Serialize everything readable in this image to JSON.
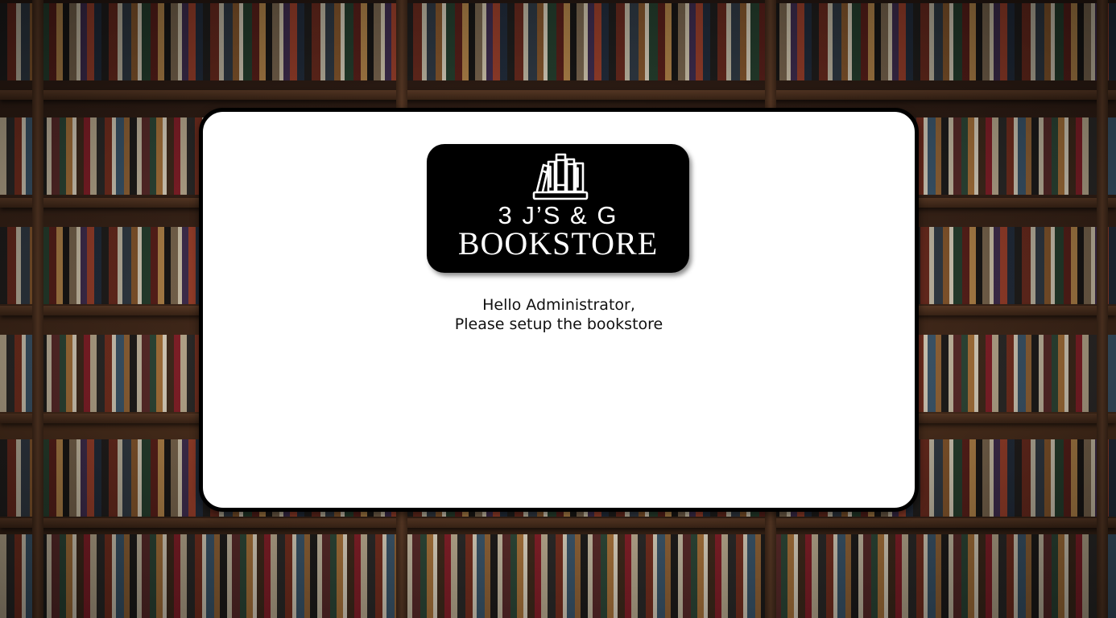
{
  "logo": {
    "icon": "bookshelf-icon",
    "line1": "3 J’S & G",
    "line2": "BOOKSTORE"
  },
  "greeting": {
    "line1": "Hello Administrator,",
    "line2": "Please setup the bookstore"
  },
  "colors": {
    "card_background": "#ffffff",
    "card_border": "#000000",
    "logo_background": "#000000",
    "logo_text": "#ffffff",
    "text": "#111111"
  }
}
